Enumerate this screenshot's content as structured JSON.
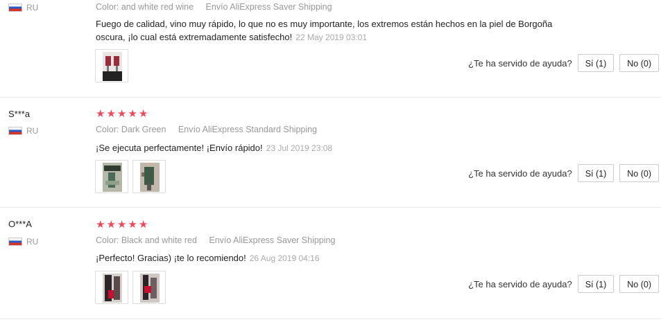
{
  "reviews": [
    {
      "user": "",
      "country": "RU",
      "color": "Color: and white red wine",
      "shipping": "Envío AliExpress Saver Shipping",
      "text": "Fuego de calidad, vino muy rápido, lo que no es muy importante, los extremos están hechos en la piel de Borgoña oscura, ¡lo cual está extremadamente satisfecho!",
      "date": "22 May 2019 03:01",
      "stars": 0,
      "photos": 1,
      "helpful_label": "¿Te ha servido de ayuda?",
      "yes_label": "Sí (1)",
      "no_label": "No (0)"
    },
    {
      "user": "S***a",
      "country": "RU",
      "color": "Color: Dark Green",
      "shipping": "Envío AliExpress Standard Shipping",
      "text": "¡Se ejecuta perfectamente! ¡Envío rápido!",
      "date": "23 Jul 2019 23:08",
      "stars": 5,
      "photos": 2,
      "helpful_label": "¿Te ha servido de ayuda?",
      "yes_label": "Sí (1)",
      "no_label": "No (0)"
    },
    {
      "user": "O***A",
      "country": "RU",
      "color": "Color: Black and white red",
      "shipping": "Envío AliExpress Saver Shipping",
      "text": "¡Perfecto! Gracias) ¡te lo recomiendo!",
      "date": "26 Aug 2019 04:16",
      "stars": 5,
      "photos": 2,
      "helpful_label": "¿Te ha servido de ayuda?",
      "yes_label": "Sí (1)",
      "no_label": "No (0)"
    }
  ],
  "colors": {
    "star": "#f0485a",
    "meta": "#999999"
  },
  "icons": {
    "flag": "russia-flag-icon",
    "star": "star-icon"
  }
}
